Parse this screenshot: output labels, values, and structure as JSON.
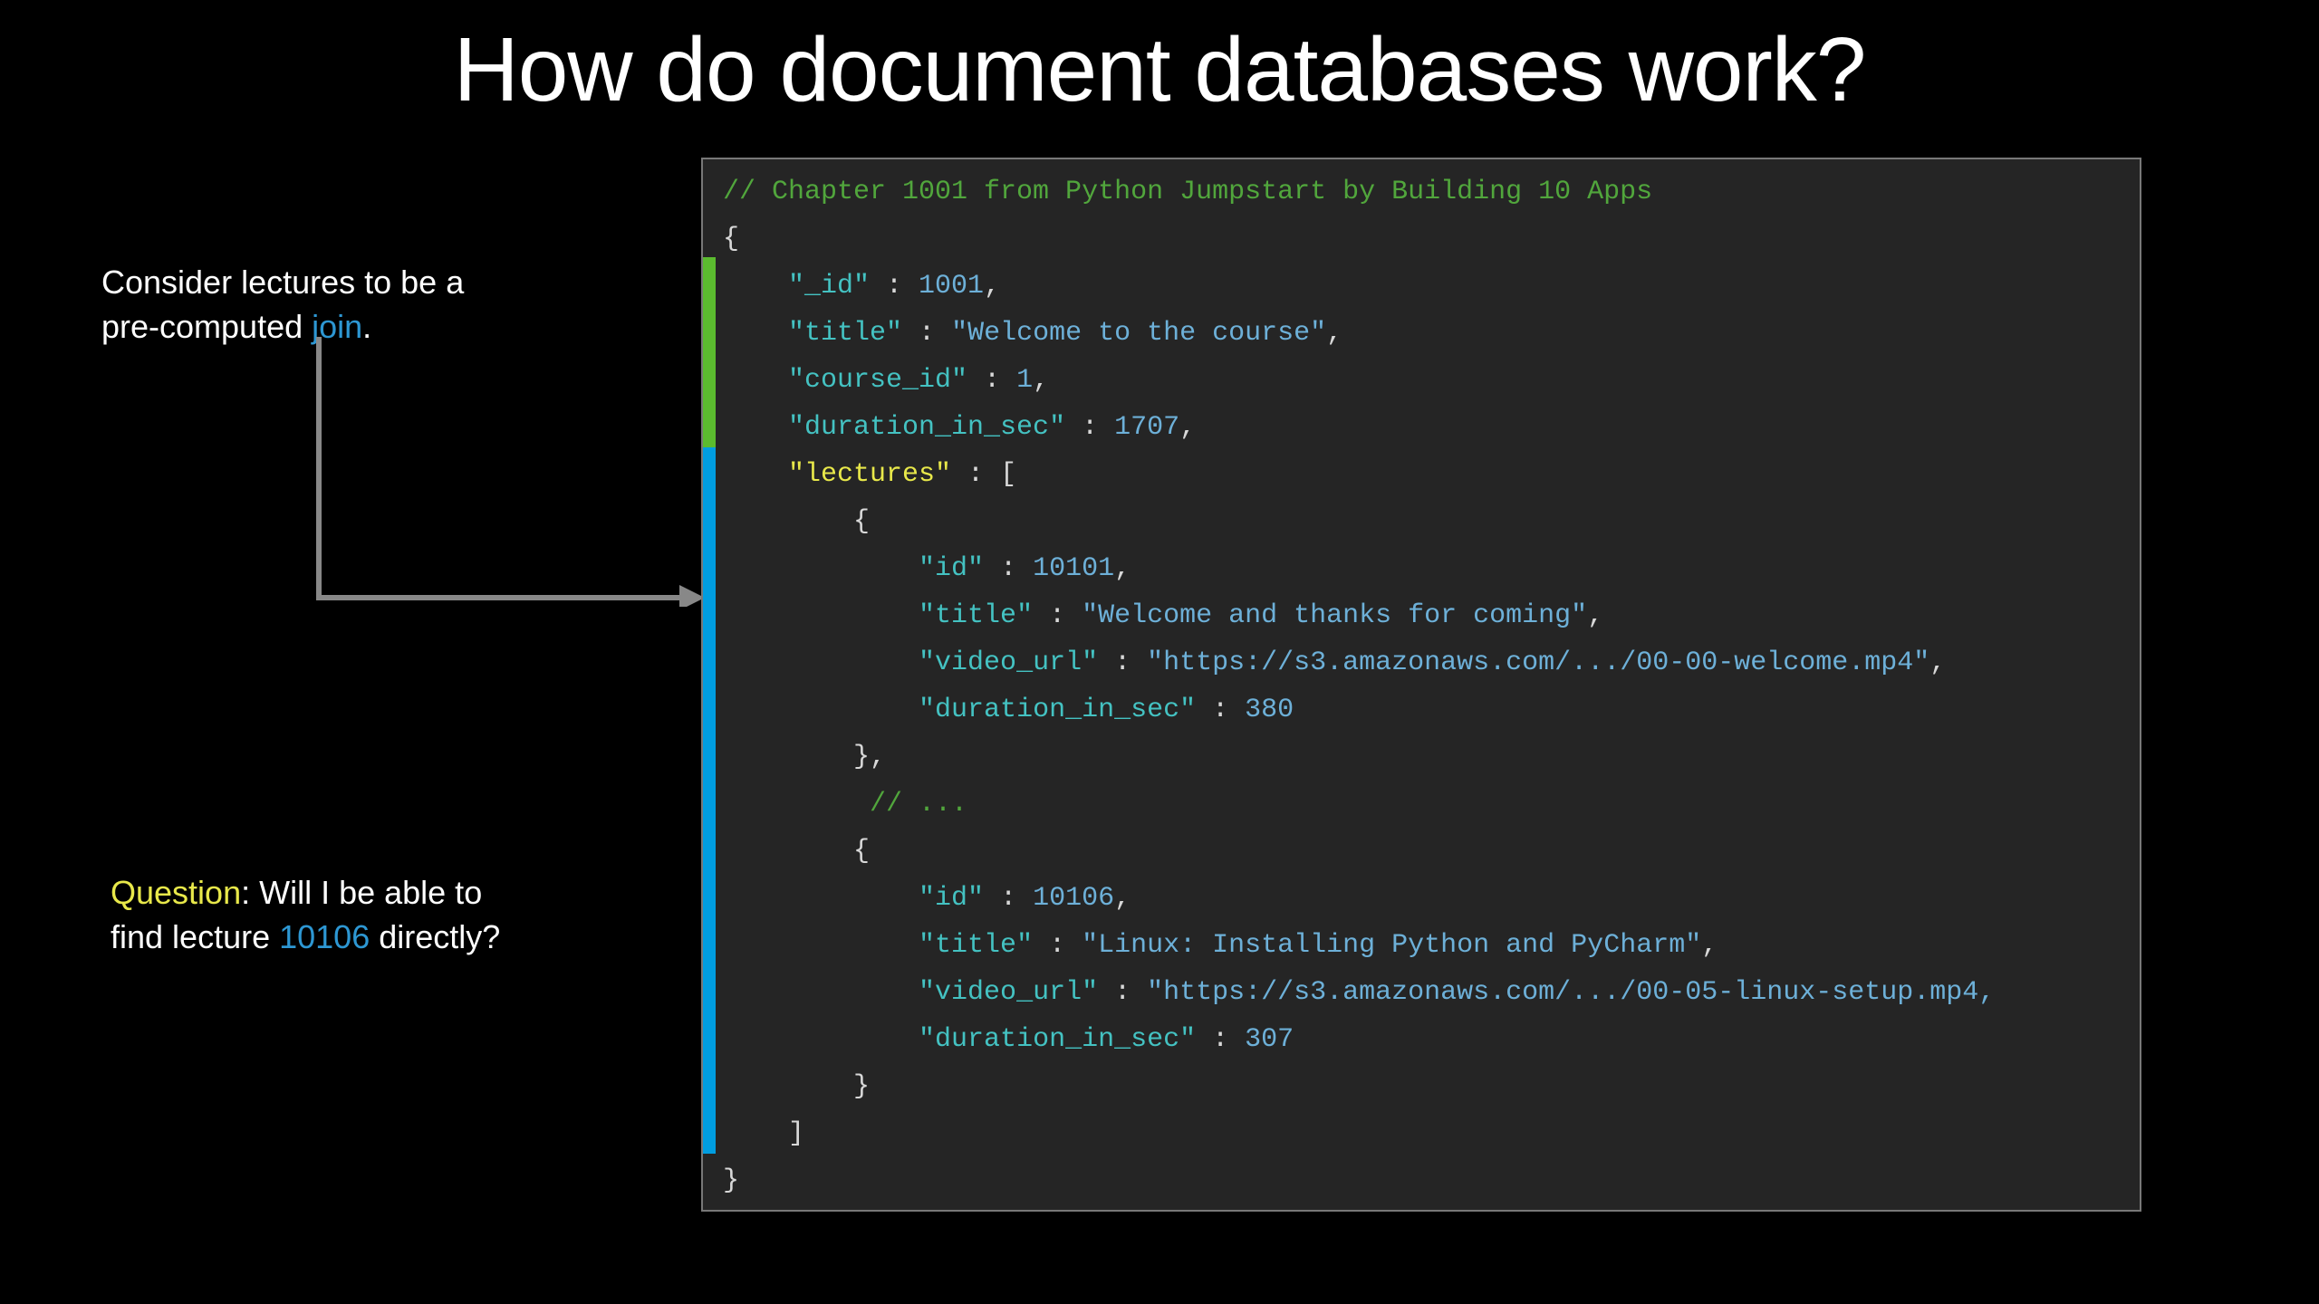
{
  "title": "How do document databases work?",
  "note1": {
    "prefix": "Consider lectures to be a ",
    "br": "pre-computed ",
    "join": "join",
    "suffix": "."
  },
  "note2": {
    "question_label": "Question",
    "text1": ": Will I be able to ",
    "text2": "find lecture ",
    "lecture_id": "10106",
    "text3": " directly?"
  },
  "code": {
    "comment": "// Chapter 1001 from Python Jumpstart by Building 10 Apps",
    "open_brace": "{",
    "id_key": "\"_id\"",
    "id_val": "1001",
    "title_key": "\"title\"",
    "title_val": "\"Welcome to the course\"",
    "course_key": "\"course_id\"",
    "course_val": "1",
    "dur_key": "\"duration_in_sec\"",
    "dur_val": "1707",
    "lectures_key": "\"lectures\"",
    "arr_open": "[",
    "obj_open": "{",
    "l1_id_key": "\"id\"",
    "l1_id_val": "10101",
    "l1_title_key": "\"title\"",
    "l1_title_val": "\"Welcome and thanks for coming\"",
    "l1_url_key": "\"video_url\"",
    "l1_url_val": "\"https://s3.amazonaws.com/.../00-00-welcome.mp4\"",
    "l1_dur_key": "\"duration_in_sec\"",
    "l1_dur_val": "380",
    "obj_close_comma": "},",
    "ellipsis_comment": "// ...",
    "l2_id_key": "\"id\"",
    "l2_id_val": "10106",
    "l2_title_key": "\"title\"",
    "l2_title_val": "\"Linux: Installing Python and PyCharm\"",
    "l2_url_key": "\"video_url\"",
    "l2_url_val": "\"https://s3.amazonaws.com/.../00-05-linux-setup.mp4,",
    "l2_dur_key": "\"duration_in_sec\"",
    "l2_dur_val": "307",
    "obj_close": "}",
    "arr_close": "]",
    "close_brace": "}",
    "colon": " : ",
    "comma": ","
  }
}
